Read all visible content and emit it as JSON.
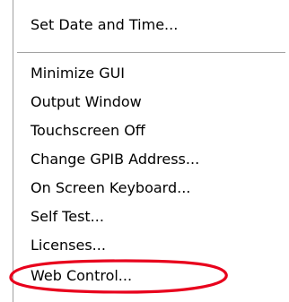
{
  "menu": {
    "items": [
      {
        "label": "Set Date and Time..."
      },
      {
        "label": "Minimize GUI"
      },
      {
        "label": "Output Window"
      },
      {
        "label": "Touchscreen Off"
      },
      {
        "label": "Change GPIB Address..."
      },
      {
        "label": "On Screen Keyboard..."
      },
      {
        "label": "Self Test..."
      },
      {
        "label": "Licenses..."
      },
      {
        "label": "Web Control..."
      }
    ]
  },
  "annotation": {
    "highlight_color": "#e8001c",
    "highlighted_item": "Web Control..."
  }
}
